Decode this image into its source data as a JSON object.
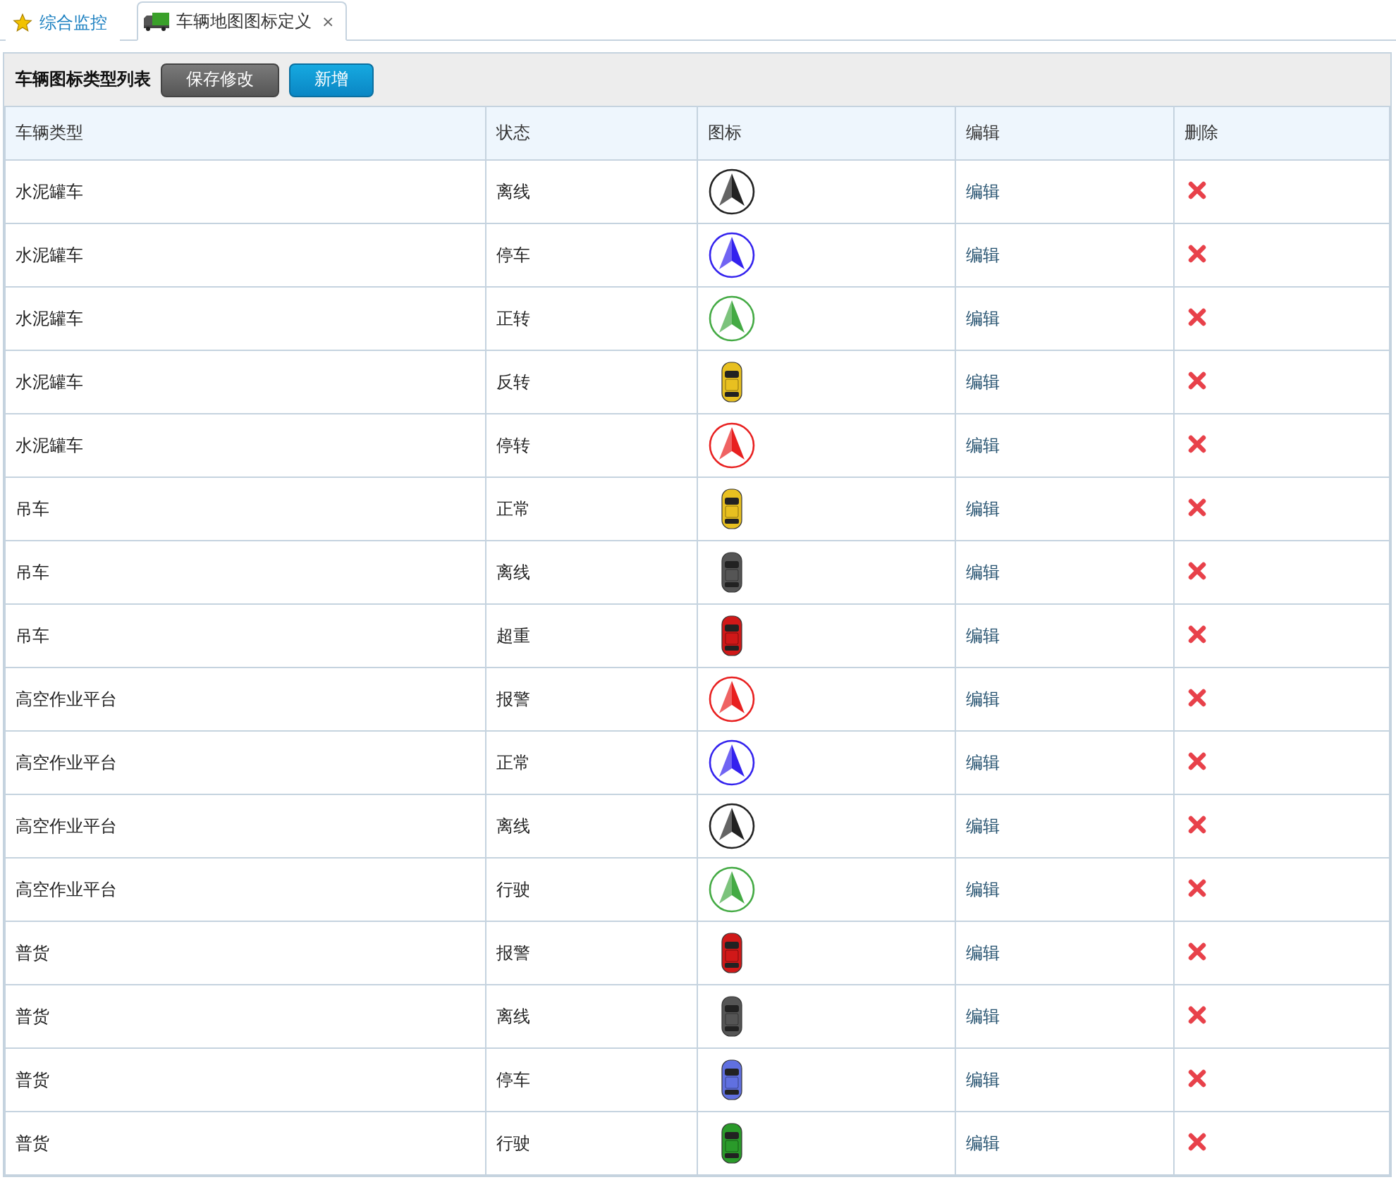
{
  "tabs": [
    {
      "label": "综合监控",
      "selected": false
    },
    {
      "label": "车辆地图图标定义",
      "selected": true,
      "close": "×"
    }
  ],
  "toolbar": {
    "title": "车辆图标类型列表",
    "buttons": [
      {
        "label": "保存修改",
        "kind": "dark"
      },
      {
        "label": "新增",
        "kind": "primary"
      }
    ]
  },
  "table": {
    "columns": [
      "车辆类型",
      "状态",
      "图标",
      "编辑",
      "删除"
    ],
    "rows": [
      {
        "type": "水泥罐车",
        "status": "离线",
        "icon": {
          "kind": "arrow",
          "color": "#222222"
        },
        "edit": "编辑"
      },
      {
        "type": "水泥罐车",
        "status": "停车",
        "icon": {
          "kind": "arrow",
          "color": "#3322ee"
        },
        "edit": "编辑"
      },
      {
        "type": "水泥罐车",
        "status": "正转",
        "icon": {
          "kind": "arrow",
          "color": "#44aa44"
        },
        "edit": "编辑"
      },
      {
        "type": "水泥罐车",
        "status": "反转",
        "icon": {
          "kind": "car",
          "color": "#e8c020"
        },
        "edit": "编辑"
      },
      {
        "type": "水泥罐车",
        "status": "停转",
        "icon": {
          "kind": "arrow",
          "color": "#e82020"
        },
        "edit": "编辑"
      },
      {
        "type": "吊车",
        "status": "正常",
        "icon": {
          "kind": "car",
          "color": "#e8c020"
        },
        "edit": "编辑"
      },
      {
        "type": "吊车",
        "status": "离线",
        "icon": {
          "kind": "car",
          "color": "#555555"
        },
        "edit": "编辑"
      },
      {
        "type": "吊车",
        "status": "超重",
        "icon": {
          "kind": "car",
          "color": "#d01818"
        },
        "edit": "编辑"
      },
      {
        "type": "高空作业平台",
        "status": "报警",
        "icon": {
          "kind": "arrow",
          "color": "#e82020"
        },
        "edit": "编辑"
      },
      {
        "type": "高空作业平台",
        "status": "正常",
        "icon": {
          "kind": "arrow",
          "color": "#3322ee"
        },
        "edit": "编辑"
      },
      {
        "type": "高空作业平台",
        "status": "离线",
        "icon": {
          "kind": "arrow",
          "color": "#222222"
        },
        "edit": "编辑"
      },
      {
        "type": "高空作业平台",
        "status": "行驶",
        "icon": {
          "kind": "arrow",
          "color": "#44aa44"
        },
        "edit": "编辑"
      },
      {
        "type": "普货",
        "status": "报警",
        "icon": {
          "kind": "car",
          "color": "#d01818"
        },
        "edit": "编辑"
      },
      {
        "type": "普货",
        "status": "离线",
        "icon": {
          "kind": "car",
          "color": "#555555"
        },
        "edit": "编辑"
      },
      {
        "type": "普货",
        "status": "停车",
        "icon": {
          "kind": "car",
          "color": "#6070e0"
        },
        "edit": "编辑"
      },
      {
        "type": "普货",
        "status": "行驶",
        "icon": {
          "kind": "car",
          "color": "#2a9a2a"
        },
        "edit": "编辑"
      }
    ]
  }
}
